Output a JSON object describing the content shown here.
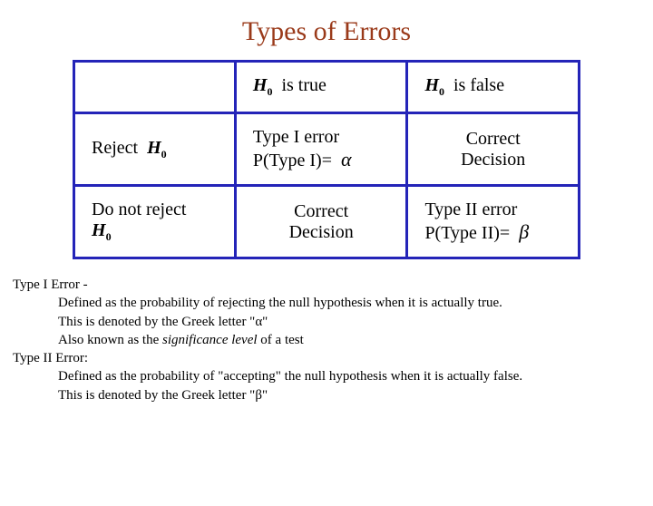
{
  "title": "Types of Errors",
  "symbols": {
    "H0_html": "<span class=\"hsym\">H<span class=\"hsub\">0</span></span>",
    "alpha": "α",
    "beta": "β"
  },
  "table": {
    "col1": "is true",
    "col2": "is false",
    "row1_label": "Reject",
    "row2_label": "Do not reject",
    "cell_r1c1_l1": "Type I error",
    "cell_r1c1_l2": "P(Type I)=",
    "cell_r1c2_l1": "Correct",
    "cell_r1c2_l2": "Decision",
    "cell_r2c1_l1": "Correct",
    "cell_r2c1_l2": "Decision",
    "cell_r2c2_l1": "Type II error",
    "cell_r2c2_l2": "P(Type II)="
  },
  "defs": {
    "t1_head": "Type I Error -",
    "t1_line1": "Defined as the probability of rejecting the null hypothesis when it is actually true.",
    "t1_line2_pre": "This is denoted by the Greek letter \"",
    "t1_line2_post": "\"",
    "t1_line3_pre": "Also known as the ",
    "t1_line3_ital": "significance level",
    "t1_line3_post": " of a test",
    "t2_head": "Type II Error:",
    "t2_line1": "Defined as the probability of \"accepting\" the null hypothesis when it is actually false.",
    "t2_line2_pre": "This is denoted by the Greek letter \"",
    "t2_line2_post": "\""
  }
}
